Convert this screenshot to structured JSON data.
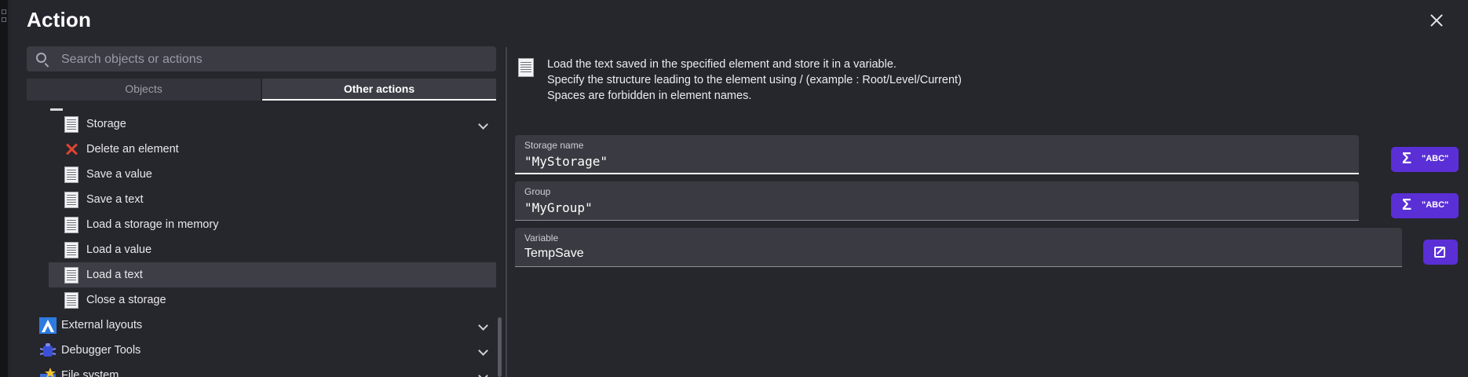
{
  "dialog": {
    "title": "Action"
  },
  "search": {
    "placeholder": "Search objects or actions"
  },
  "tabs": [
    {
      "label": "Objects"
    },
    {
      "label": "Other actions"
    }
  ],
  "tree": {
    "items": [
      {
        "label": "Storage",
        "icon": "storage-doc-icon",
        "expanded": true
      },
      {
        "label": "Delete an element",
        "icon": "delete-x-icon"
      },
      {
        "label": "Save a value",
        "icon": "doc-icon"
      },
      {
        "label": "Save a text",
        "icon": "doc-icon"
      },
      {
        "label": "Load a storage in memory",
        "icon": "doc-icon"
      },
      {
        "label": "Load a value",
        "icon": "doc-icon"
      },
      {
        "label": "Load a text",
        "icon": "doc-icon",
        "selected": true
      },
      {
        "label": "Close a storage",
        "icon": "doc-icon"
      },
      {
        "label": "External layouts",
        "icon": "external-layouts-icon"
      },
      {
        "label": "Debugger Tools",
        "icon": "debugger-tools-icon"
      },
      {
        "label": "File system",
        "icon": "file-system-icon"
      }
    ]
  },
  "description": {
    "lines": [
      "Load the text saved in the specified element and store it in a variable.",
      "Specify the structure leading to the element using / (example : Root/Level/Current)",
      "Spaces are forbidden in element names."
    ]
  },
  "fields": [
    {
      "label": "Storage name",
      "value": "\"MyStorage\""
    },
    {
      "label": "Group",
      "value": "\"MyGroup\""
    },
    {
      "label": "Variable",
      "value": "TempSave"
    }
  ],
  "buttons": {
    "sigma": "Σ",
    "abc": "\"ABC\""
  },
  "colors": {
    "accent": "#5a2fd6",
    "background": "#26262d",
    "selected_row": "#3e3e47"
  }
}
